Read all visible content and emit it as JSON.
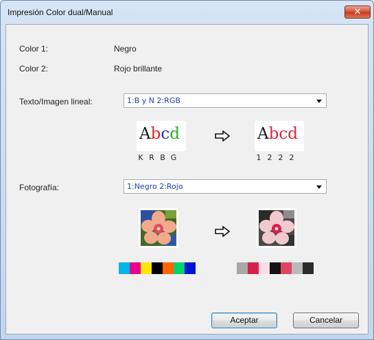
{
  "window": {
    "title": "Impresión Color dual/Manual",
    "close_label": "✕"
  },
  "info": {
    "color1_label": "Color 1:",
    "color1_value": "Negro",
    "color2_label": "Color 2:",
    "color2_value": "Rojo brillante"
  },
  "text_image": {
    "label": "Texto/Imagen lineal:",
    "selected": "1:B y N 2:RGB",
    "sample_before": {
      "letters": [
        "A",
        "b",
        "c",
        "d"
      ],
      "colors": [
        "#1a1a1a",
        "#e02020",
        "#2030d0",
        "#20b020"
      ],
      "codes": [
        "K",
        "R",
        "B",
        "G"
      ]
    },
    "sample_after": {
      "letters": [
        "A",
        "b",
        "c",
        "d"
      ],
      "colors": [
        "#1a1a1a",
        "#e02040",
        "#e02040",
        "#e02040"
      ],
      "codes": [
        "1",
        "2",
        "2",
        "2"
      ]
    }
  },
  "photo": {
    "label": "Fotografía:",
    "selected": "1:Negro 2:Rojo",
    "swatches_before": [
      "#00b4e6",
      "#e6008c",
      "#ffe600",
      "#000000",
      "#ff6400",
      "#00d26e",
      "#0014d2"
    ],
    "swatches_after": [
      "#a8a8a8",
      "#d8204a",
      "#f8dde4",
      "#141414",
      "#e04462",
      "#b9b9b9",
      "#2a2a2a"
    ]
  },
  "buttons": {
    "ok_label": "Aceptar",
    "cancel_label": "Cancelar"
  }
}
